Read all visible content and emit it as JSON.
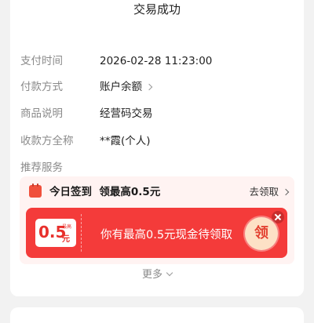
{
  "status": "交易成功",
  "details": [
    {
      "key": "time",
      "label": "支付时间",
      "value": "2026-02-28 11:23:00"
    },
    {
      "key": "method",
      "label": "付款方式",
      "value": "账户余额"
    },
    {
      "key": "desc",
      "label": "商品说明",
      "value": "经营码交易"
    },
    {
      "key": "payee",
      "label": "收款方全称",
      "value": "**霞(个人)"
    }
  ],
  "services_label": "推荐服务",
  "signin": {
    "icon": "calendar-icon",
    "title": "今日签到  领最高0.5元",
    "link": "去领取"
  },
  "banner": {
    "coupon_amount": "0.5",
    "coupon_tag": "最高",
    "coupon_unit": "元",
    "text": "你有最高0.5元现金待领取",
    "claim_label": "领"
  },
  "more_label": "更多",
  "colors": {
    "accent": "#f43b3a",
    "card_tint": "#fff3f2",
    "claim_bg": "#fde1c6"
  }
}
